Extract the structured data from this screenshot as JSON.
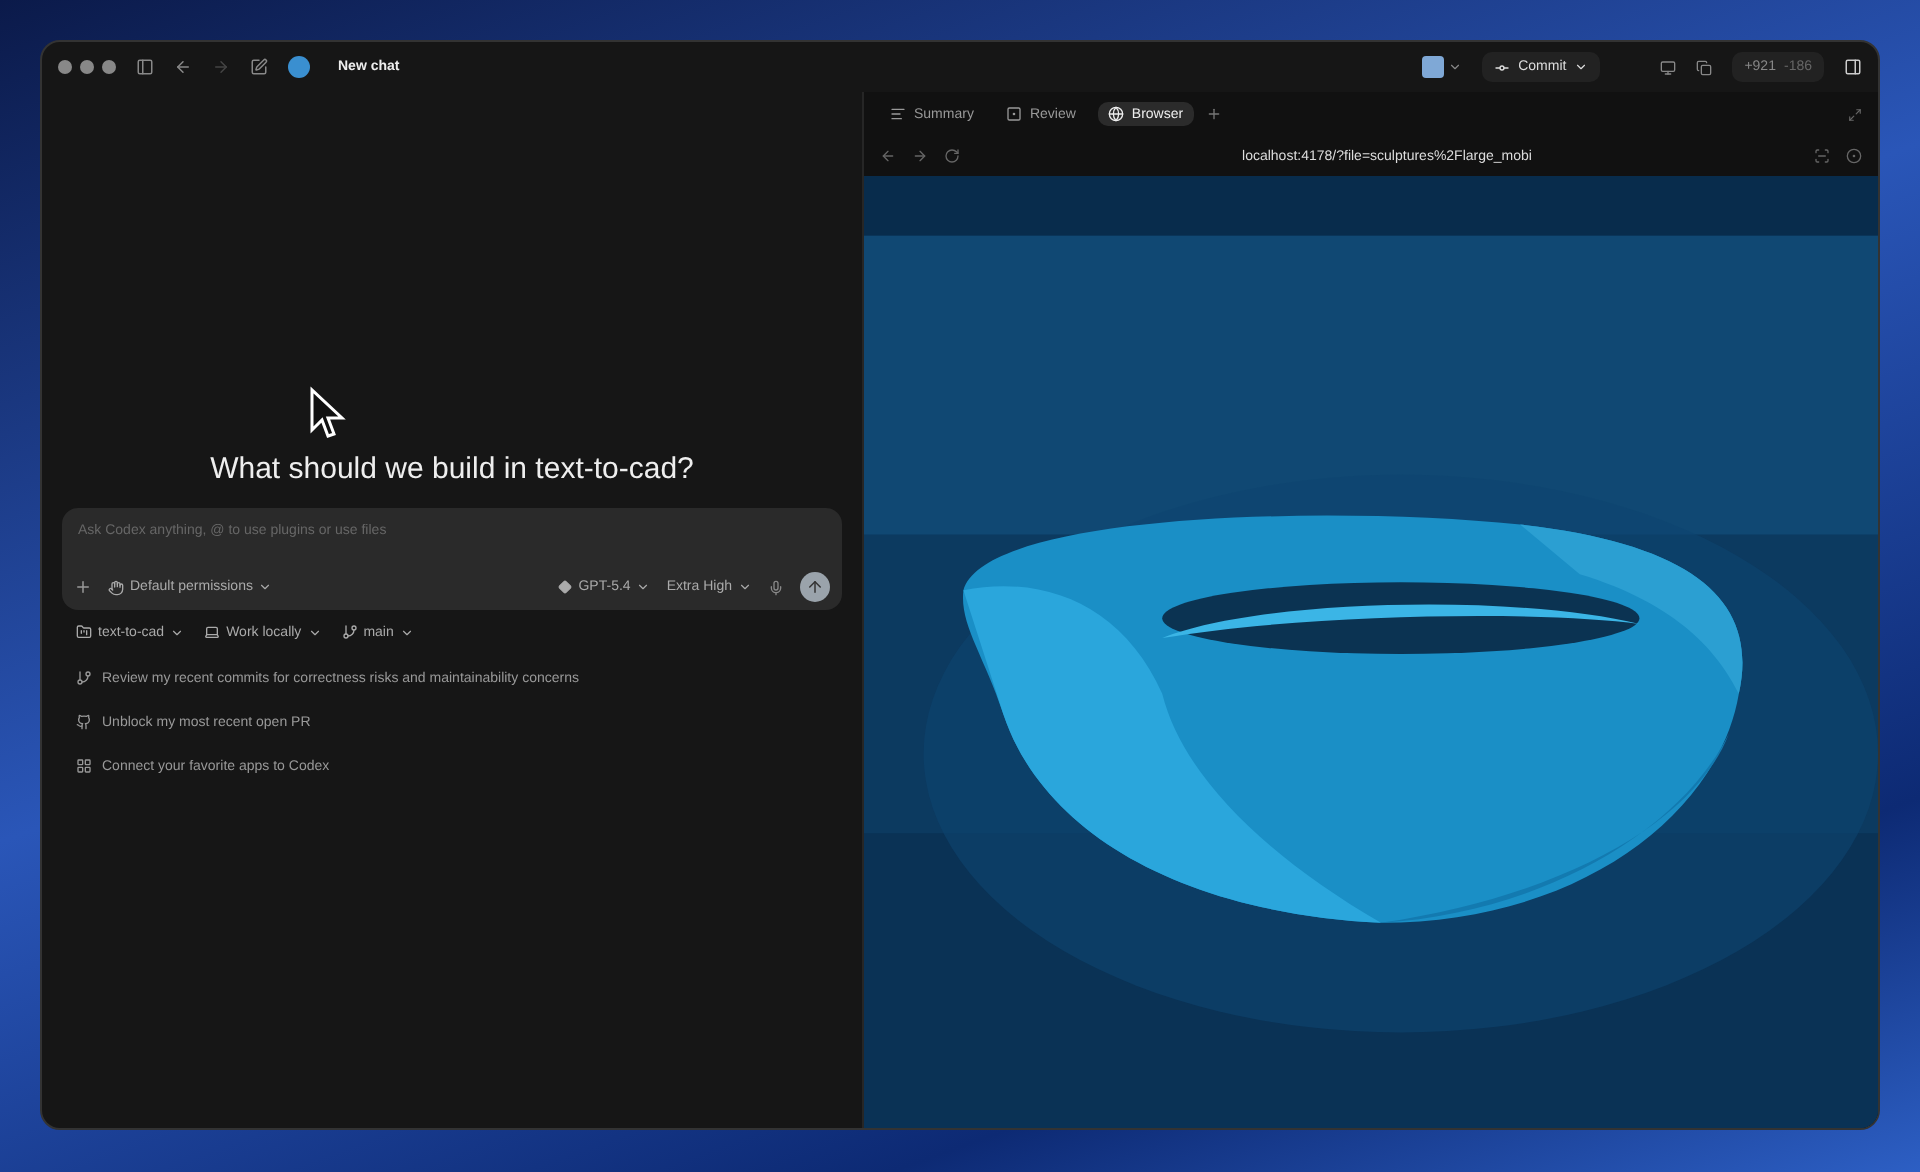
{
  "window": {
    "title": "New chat"
  },
  "toolbar": {
    "commit_label": "Commit",
    "added": "+921",
    "removed": "-186"
  },
  "tabs": [
    {
      "label": "Summary",
      "kind": "summary",
      "selected": false
    },
    {
      "label": "Review",
      "kind": "review",
      "selected": false
    },
    {
      "label": "Browser",
      "kind": "browser",
      "selected": true
    }
  ],
  "browser": {
    "url": "localhost:4178/?file=sculptures%2Flarge_mobi"
  },
  "chat": {
    "heading": "What should we build in text-to-cad?",
    "composer": {
      "placeholder": "Ask Codex anything, @ to use plugins or use files",
      "permissions": "Default permissions",
      "model": "GPT-5.4",
      "effort": "Extra High"
    },
    "context": [
      {
        "label": "text-to-cad",
        "kind": "project"
      },
      {
        "label": "Work locally",
        "kind": "local"
      },
      {
        "label": "main",
        "kind": "branch"
      }
    ],
    "suggestions": [
      {
        "text": "Review my recent commits for correctness risks and maintainability concerns",
        "kind": "branch"
      },
      {
        "text": "Unblock my most recent open PR",
        "kind": "github"
      },
      {
        "text": "Connect your favorite apps to Codex",
        "kind": "apps"
      }
    ]
  }
}
